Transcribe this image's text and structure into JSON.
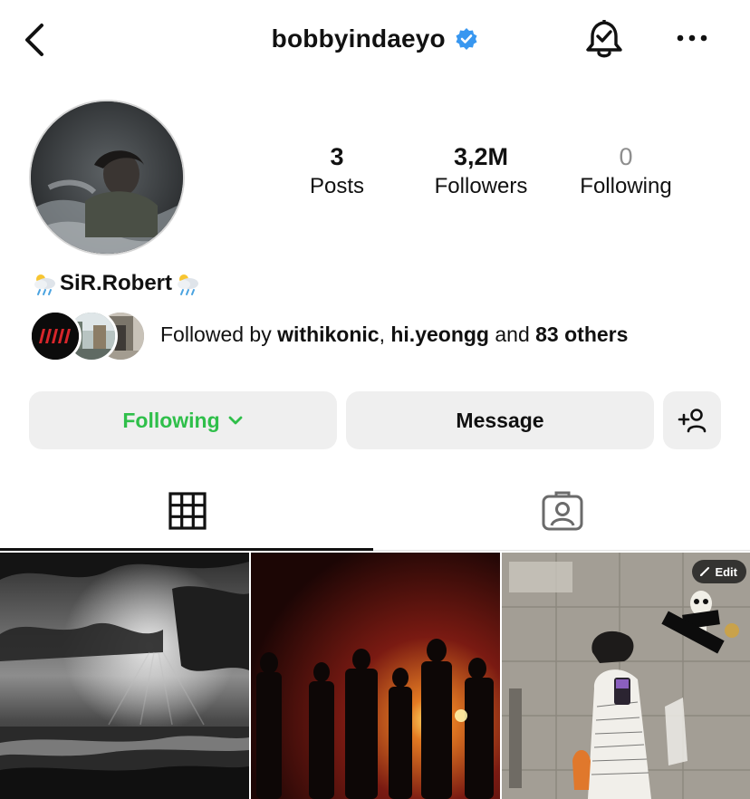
{
  "header": {
    "username": "bobbyindaeyo",
    "verified_icon": "verified-badge-icon",
    "back_icon": "chevron-left-icon",
    "notify_icon": "bell-check-icon",
    "more_icon": "more-horizontal-icon"
  },
  "stats": {
    "posts": {
      "value": "3",
      "label": "Posts"
    },
    "followers": {
      "value": "3,2M",
      "label": "Followers"
    },
    "following": {
      "value": "0",
      "label": "Following"
    }
  },
  "profile": {
    "display_name": "SiR.Robert",
    "name_emoji": "cloud-with-rain-icon"
  },
  "followed_by": {
    "prefix": "Followed by ",
    "user1": "withikonic",
    "separator": ", ",
    "user2": "hi.yeongg",
    "middle": " and ",
    "others": "83 others"
  },
  "actions": {
    "following_label": "Following",
    "message_label": "Message",
    "add_user_icon": "add-person-icon"
  },
  "tabs": [
    {
      "name": "grid",
      "icon": "grid-icon",
      "active": true
    },
    {
      "name": "tagged",
      "icon": "tagged-person-icon",
      "active": false
    }
  ],
  "posts": [
    {
      "edit_label": ""
    },
    {
      "edit_label": ""
    },
    {
      "edit_label": "Edit"
    }
  ],
  "colors": {
    "following_green": "#2fbf4a",
    "verified_blue": "#3897f0",
    "button_bg": "#efefef"
  }
}
